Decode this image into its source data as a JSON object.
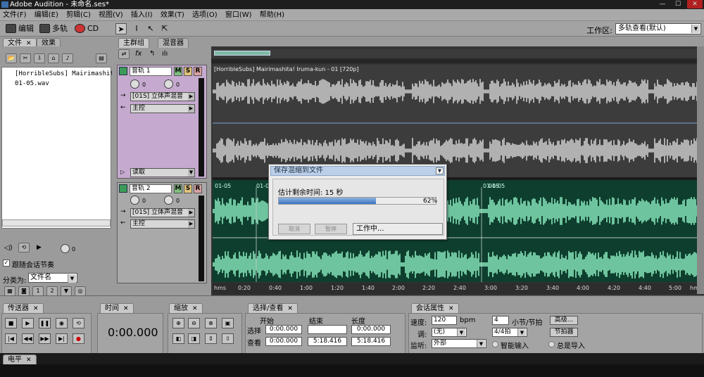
{
  "titlebar": {
    "title": "Adobe Audition - 未命名.ses*",
    "minimize": "—",
    "maximize": "☐",
    "close": "✕"
  },
  "menu": [
    "文件(F)",
    "编辑(E)",
    "剪辑(C)",
    "视图(V)",
    "插入(I)",
    "效果(T)",
    "选项(O)",
    "窗口(W)",
    "帮助(H)"
  ],
  "toolbar": {
    "edit": "编辑",
    "multitrack": "多轨",
    "cd": "CD",
    "workspace_label": "工作区:",
    "workspace_value": "多轨查看(默认)"
  },
  "file_panel": {
    "tabs": [
      "文件",
      "效果"
    ],
    "files": [
      "[HorribleSubs] Mairimashit",
      "01-05.wav"
    ],
    "knob_value": "0",
    "follow_checkbox": "跟随会话节奏",
    "sort_label": "分类为:",
    "sort_value": "文件名"
  },
  "main_tabs": [
    "主群组",
    "混音器"
  ],
  "tracks": [
    {
      "name": "音轨 1",
      "vol": "0",
      "pan": "0",
      "input": "[01S] 立体声混音",
      "output": "主控",
      "mode": "读取"
    },
    {
      "name": "音轨 2",
      "vol": "0",
      "pan": "0",
      "input": "[01S] 立体声混音",
      "output": "主控"
    }
  ],
  "msr": {
    "m": "M",
    "s": "S",
    "r": "R"
  },
  "clips": {
    "clip1_title": "[HorribleSubs] Mairimashita! Iruma-kun - 01 [720p]",
    "clip2_labels": [
      "01-05",
      "01-0",
      "01-05",
      "01-05"
    ]
  },
  "ruler": [
    "hms",
    "0:20",
    "0:40",
    "1:00",
    "1:20",
    "1:40",
    "2:00",
    "2:20",
    "2:40",
    "3:00",
    "3:20",
    "3:40",
    "4:00",
    "4:20",
    "4:40",
    "5:00",
    "hms"
  ],
  "dialog": {
    "title": "保存混缩到文件",
    "estimate": "估计剩余时间: 15 秒",
    "progress": 0.62,
    "percent": "62%",
    "cancel": "取消",
    "pause": "暂停",
    "status": "工作中..."
  },
  "bottom": {
    "transport_tab": "传送器",
    "time_tab": "时间",
    "time_value": "0:00.000",
    "zoom_tab": "缩放",
    "selection_tab": "选择/查看",
    "sel_headers": [
      "开始",
      "结束",
      "长度"
    ],
    "sel_row_label": "选择",
    "view_row_label": "查看",
    "sel_start": "0:00.000",
    "sel_end": "",
    "sel_len": "0:00.000",
    "view_start": "0:00.000",
    "view_end": "5:18.416",
    "view_len": "5:18.416",
    "session_tab": "会话属性",
    "tempo_label": "速度:",
    "tempo_value": "120",
    "bpm": "bpm",
    "beats_value": "4",
    "beats_label": "小节/节拍",
    "advanced": "高级...",
    "key_label": "调:",
    "key_value": "(无)",
    "time_sig": "4/4拍",
    "metronome": "节拍器",
    "monitor_label": "监听:",
    "monitor_value": "外部",
    "smart_input": "智能输入",
    "always_input": "总是导入",
    "level_tab": "电平"
  }
}
